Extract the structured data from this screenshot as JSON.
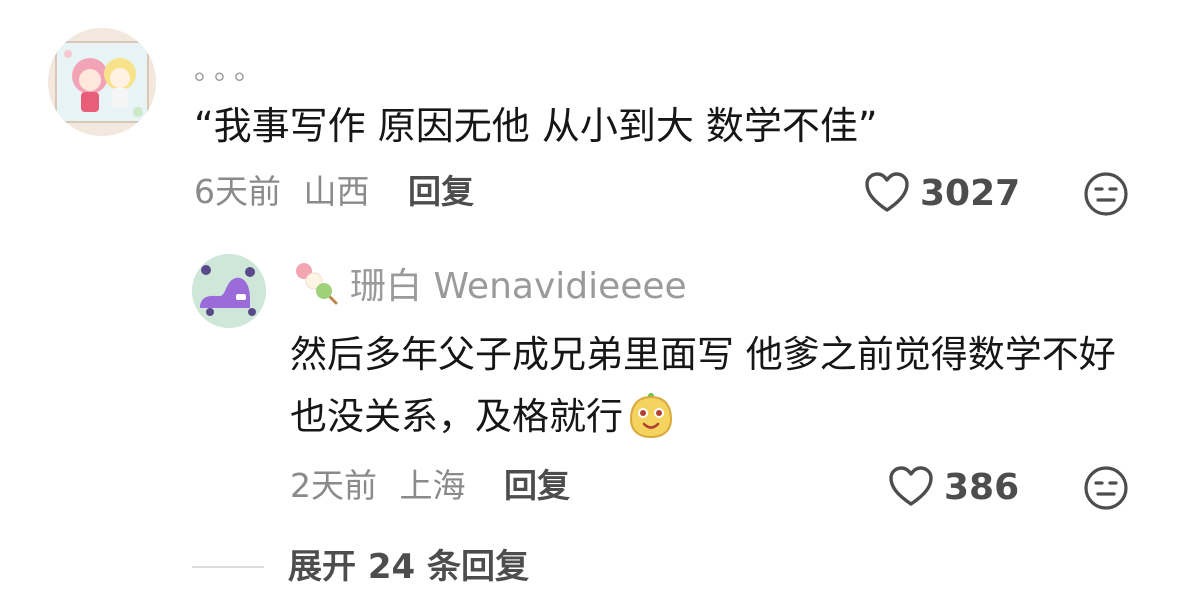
{
  "comment": {
    "username": "。。。",
    "text": "“我事写作 原因无他 从小到大 数学不佳”",
    "time": "6天前",
    "location": "山西",
    "reply_label": "回复",
    "likes": "3027",
    "avatar_icon": "anime-avatar",
    "like_icon": "heart-icon",
    "dislike_icon": "meh-face-icon"
  },
  "reply": {
    "badge_icon": "dango-icon",
    "username": "珊白 Wenavidieeee",
    "text": "然后多年父子成兄弟里面写 他爹之前觉得数学不好也没关系，及格就行",
    "emoji_icon": "smiling-fruit-emoji",
    "time": "2天前",
    "location": "上海",
    "reply_label": "回复",
    "likes": "386",
    "avatar_icon": "purple-creature-avatar",
    "like_icon": "heart-icon",
    "dislike_icon": "meh-face-icon"
  },
  "expand": {
    "label": "展开 24 条回复"
  },
  "colors": {
    "primary_text": "#161616",
    "secondary_text": "#8a8a8a",
    "action_text": "#4d4d4d",
    "divider": "#dcdcdc"
  }
}
